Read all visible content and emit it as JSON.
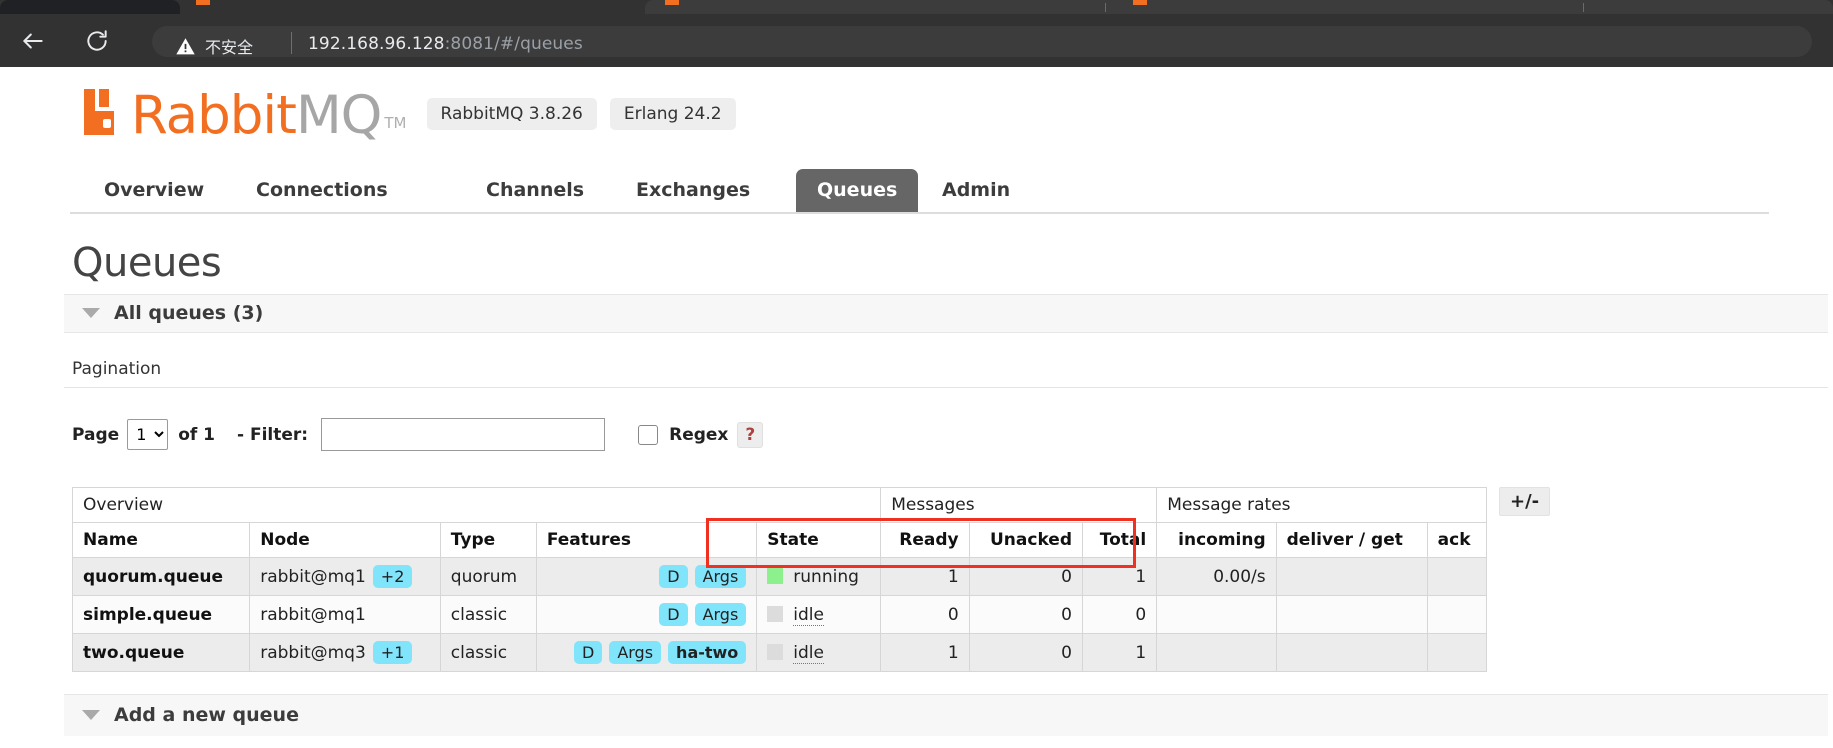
{
  "browser": {
    "secure_label": "不安全",
    "url_host": "192.168.96.128",
    "url_rest": ":8081/#/queues",
    "back_icon": "back-arrow-icon",
    "reload_icon": "reload-icon",
    "warning_icon": "warning-triangle-icon"
  },
  "header": {
    "logo_rabbit": "Rabbit",
    "logo_mq": "MQ",
    "logo_tm": "TM",
    "version_badges": [
      "RabbitMQ 3.8.26",
      "Erlang 24.2"
    ]
  },
  "nav": {
    "tabs": [
      {
        "label": "Overview",
        "active": false
      },
      {
        "label": "Connections",
        "active": false
      },
      {
        "label": "Channels",
        "active": false
      },
      {
        "label": "Exchanges",
        "active": false
      },
      {
        "label": "Queues",
        "active": true
      },
      {
        "label": "Admin",
        "active": false
      }
    ]
  },
  "main": {
    "page_title": "Queues",
    "all_queues_title": "All queues (3)",
    "pagination_label": "Pagination",
    "page_label": "Page",
    "page_value": "1",
    "page_options": [
      "1"
    ],
    "of_label": "of 1",
    "filter_label": "- Filter:",
    "filter_value": "",
    "regex_label": "Regex",
    "help_label": "?",
    "plusminus_label": "+/-",
    "add_queue_title": "Add a new queue"
  },
  "table": {
    "groups": [
      {
        "label": "Overview",
        "span": 5
      },
      {
        "label": "Messages",
        "span": 3
      },
      {
        "label": "Message rates",
        "span": 3
      }
    ],
    "columns": [
      {
        "label": "Name",
        "align": "left"
      },
      {
        "label": "Node",
        "align": "left"
      },
      {
        "label": "Type",
        "align": "left"
      },
      {
        "label": "Features",
        "align": "left"
      },
      {
        "label": "State",
        "align": "left"
      },
      {
        "label": "Ready",
        "align": "right"
      },
      {
        "label": "Unacked",
        "align": "right"
      },
      {
        "label": "Total",
        "align": "right"
      },
      {
        "label": "incoming",
        "align": "right"
      },
      {
        "label": "deliver / get",
        "align": "left"
      },
      {
        "label": "ack",
        "align": "left"
      }
    ],
    "rows": [
      {
        "name": "quorum.queue",
        "node": "rabbit@mq1",
        "node_extra": "+2",
        "type": "quorum",
        "features": [
          {
            "label": "D",
            "bold": false
          },
          {
            "label": "Args",
            "bold": false
          }
        ],
        "state": "running",
        "state_color": "green",
        "ready": "1",
        "unacked": "0",
        "total": "1",
        "incoming": "0.00/s",
        "deliver_get": "",
        "ack": ""
      },
      {
        "name": "simple.queue",
        "node": "rabbit@mq1",
        "node_extra": "",
        "type": "classic",
        "features": [
          {
            "label": "D",
            "bold": false
          },
          {
            "label": "Args",
            "bold": false
          }
        ],
        "state": "idle",
        "state_color": "grey",
        "ready": "0",
        "unacked": "0",
        "total": "0",
        "incoming": "",
        "deliver_get": "",
        "ack": ""
      },
      {
        "name": "two.queue",
        "node": "rabbit@mq3",
        "node_extra": "+1",
        "type": "classic",
        "features": [
          {
            "label": "D",
            "bold": false
          },
          {
            "label": "Args",
            "bold": false
          },
          {
            "label": "ha-two",
            "bold": true
          }
        ],
        "state": "idle",
        "state_color": "grey",
        "ready": "1",
        "unacked": "0",
        "total": "1",
        "incoming": "",
        "deliver_get": "",
        "ack": ""
      }
    ]
  },
  "colors": {
    "brand_orange": "#f26f21",
    "badge_cyan": "#80e4fb",
    "state_running": "#8cf08c",
    "state_idle": "#dcdcdc",
    "annotation_red": "#f03020",
    "active_tab_bg": "#666666"
  }
}
